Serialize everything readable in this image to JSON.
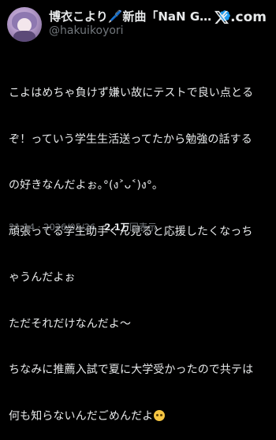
{
  "author": {
    "display_name": "博衣こより🖊️新曲「NaN GAM…",
    "handle": "@hakuikoyori",
    "verified": true
  },
  "brand": {
    "icon": "x-logo-icon",
    "text": ".com"
  },
  "tweet": {
    "lines": [
      "こよはめちゃ負けず嫌い故にテストで良い点とる",
      "ぞ！っていう学生生活送ってたから勉強の話する",
      "の好きなんだよぉ｡°(ง˃ᴗ˂)ง°｡",
      "頑張ってる学生助手くん見ると応援したくなっち",
      "ゃうんだよぉ",
      "ただそれだけなんだよ〜",
      "ちなみに推薦入試で夏に大学受かったので共テは",
      "何も知らないんだごめんだよ"
    ],
    "trailing_emoji": "pleading-face-emoji"
  },
  "meta": {
    "time": "21:14",
    "separator": "·",
    "date": "2026/05/26",
    "views_count": "2.1万",
    "views_label": "回表示"
  },
  "colors": {
    "background": "#000000",
    "text": "#e7e9ea",
    "muted": "#71767b",
    "verified": "#1d9bf0"
  }
}
